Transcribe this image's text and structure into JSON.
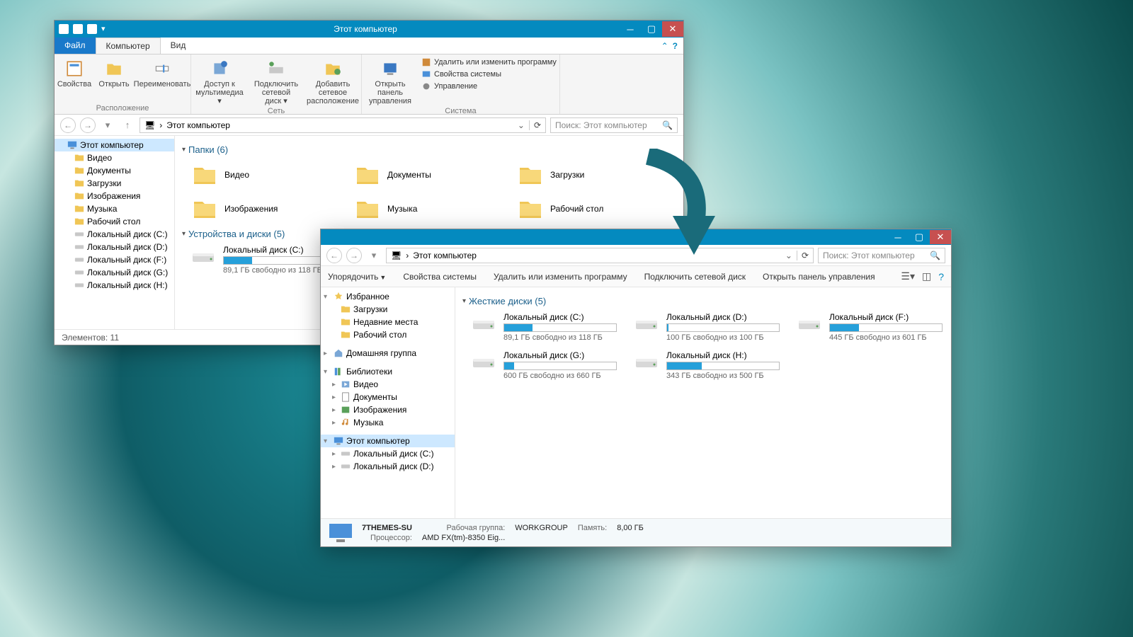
{
  "w1": {
    "title": "Этот компьютер",
    "tabs": {
      "file": "Файл",
      "computer": "Компьютер",
      "view": "Вид"
    },
    "ribbon": {
      "g1": {
        "label": "Расположение",
        "items": [
          "Свойства",
          "Открыть",
          "Переименовать"
        ]
      },
      "g2": {
        "label": "Сеть",
        "items": [
          "Доступ к мультимедиа ▾",
          "Подключить сетевой диск ▾",
          "Добавить сетевое расположение"
        ]
      },
      "g3": {
        "label": "Система",
        "items": [
          "Открыть панель управления"
        ],
        "small": [
          "Удалить или изменить программу",
          "Свойства системы",
          "Управление"
        ]
      }
    },
    "breadcrumb": "Этот компьютер",
    "search_ph": "Поиск: Этот компьютер",
    "tree": [
      {
        "t": "Этот компьютер",
        "sel": true,
        "ico": "pc"
      },
      {
        "t": "Видео",
        "l": 1,
        "ico": "fold"
      },
      {
        "t": "Документы",
        "l": 1,
        "ico": "fold"
      },
      {
        "t": "Загрузки",
        "l": 1,
        "ico": "fold"
      },
      {
        "t": "Изображения",
        "l": 1,
        "ico": "fold"
      },
      {
        "t": "Музыка",
        "l": 1,
        "ico": "fold"
      },
      {
        "t": "Рабочий стол",
        "l": 1,
        "ico": "fold"
      },
      {
        "t": "Локальный диск (C:)",
        "l": 1,
        "ico": "disk"
      },
      {
        "t": "Локальный диск (D:)",
        "l": 1,
        "ico": "disk"
      },
      {
        "t": "Локальный диск (F:)",
        "l": 1,
        "ico": "disk"
      },
      {
        "t": "Локальный диск (G:)",
        "l": 1,
        "ico": "disk"
      },
      {
        "t": "Локальный диск (H:)",
        "l": 1,
        "ico": "disk"
      }
    ],
    "folders_hdr": "Папки (6)",
    "folders": [
      "Видео",
      "Документы",
      "Загрузки",
      "Изображения",
      "Музыка",
      "Рабочий стол"
    ],
    "drives_hdr": "Устройства и диски (5)",
    "drives": [
      {
        "name": "Локальный диск (C:)",
        "free": "89,1 ГБ свободно из 118 ГБ",
        "pct": 25
      },
      {
        "name": "Локальный диск (G:)",
        "free": "600 ГБ свободно из 660 ГБ",
        "pct": 9
      }
    ],
    "status": "Элементов: 11"
  },
  "w2": {
    "breadcrumb": "Этот компьютер",
    "search_ph": "Поиск: Этот компьютер",
    "toolbar": [
      "Упорядочить",
      "Свойства системы",
      "Удалить или изменить программу",
      "Подключить сетевой диск",
      "Открыть панель управления"
    ],
    "tree": [
      {
        "t": "Избранное",
        "exp": true,
        "ico": "star"
      },
      {
        "t": "Загрузки",
        "l": 1,
        "ico": "fold"
      },
      {
        "t": "Недавние места",
        "l": 1,
        "ico": "fold"
      },
      {
        "t": "Рабочий стол",
        "l": 1,
        "ico": "fold"
      },
      {
        "sp": true
      },
      {
        "t": "Домашняя группа",
        "exp": false,
        "ico": "home"
      },
      {
        "sp": true
      },
      {
        "t": "Библиотеки",
        "exp": true,
        "ico": "lib"
      },
      {
        "t": "Видео",
        "l": 1,
        "exp2": true,
        "ico": "vid"
      },
      {
        "t": "Документы",
        "l": 1,
        "exp2": true,
        "ico": "doc"
      },
      {
        "t": "Изображения",
        "l": 1,
        "exp2": true,
        "ico": "img"
      },
      {
        "t": "Музыка",
        "l": 1,
        "exp2": true,
        "ico": "mus"
      },
      {
        "sp": true
      },
      {
        "t": "Этот компьютер",
        "exp": true,
        "sel": true,
        "ico": "pc"
      },
      {
        "t": "Локальный диск (C:)",
        "l": 1,
        "exp2": true,
        "ico": "disk"
      },
      {
        "t": "Локальный диск (D:)",
        "l": 1,
        "exp2": true,
        "ico": "disk"
      }
    ],
    "drives_hdr": "Жесткие диски (5)",
    "drives": [
      {
        "name": "Локальный диск (C:)",
        "free": "89,1 ГБ свободно из 118 ГБ",
        "pct": 25
      },
      {
        "name": "Локальный диск (D:)",
        "free": "100 ГБ свободно из 100 ГБ",
        "pct": 1
      },
      {
        "name": "Локальный диск (F:)",
        "free": "445 ГБ свободно из 601 ГБ",
        "pct": 26
      },
      {
        "name": "Локальный диск (G:)",
        "free": "600 ГБ свободно из 660 ГБ",
        "pct": 9
      },
      {
        "name": "Локальный диск (H:)",
        "free": "343 ГБ свободно из 500 ГБ",
        "pct": 31
      }
    ],
    "status": {
      "name": "7THEMES-SU",
      "k1": "Рабочая группа:",
      "v1": "WORKGROUP",
      "k2": "Память:",
      "v2": "8,00 ГБ",
      "k3": "Процессор:",
      "v3": "AMD FX(tm)-8350 Eig..."
    }
  }
}
